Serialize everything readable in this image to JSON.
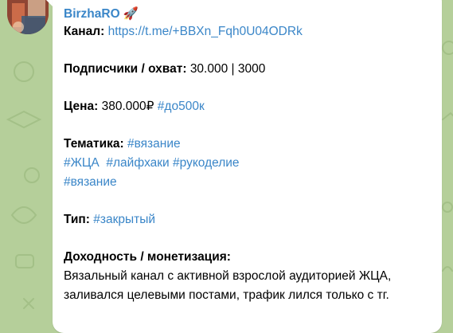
{
  "colors": {
    "background": "#b5cf9a",
    "bubble": "#ffffff",
    "link": "#3a86c8",
    "text": "#000000"
  },
  "avatar_icon": "profile-photo",
  "message": {
    "sender": "BirzhaRO",
    "sender_emoji": "🚀",
    "channel_label": "Канал:",
    "channel_link": "https://t.me/+BBXn_Fqh0U04ODRk",
    "subscribers_label": "Подписчики / охват:",
    "subscribers_value": "30.000 | 3000",
    "price_label": "Цена:",
    "price_value": "380.000₽",
    "price_tag": "#до500к",
    "topic_label": "Тематика:",
    "topic_tags": [
      "#вязание",
      "#ЖЦА",
      "#лайфхаки",
      "#рукоделие",
      "#вязание"
    ],
    "type_label": "Тип:",
    "type_tag": "#закрытый",
    "income_label": "Доходность / монетизация:",
    "description_lines": [
      "Вязальный канал с активной взрослой аудиторией ЖЦА,",
      "заливался целевыми постами, трафик лился только с тг."
    ]
  }
}
